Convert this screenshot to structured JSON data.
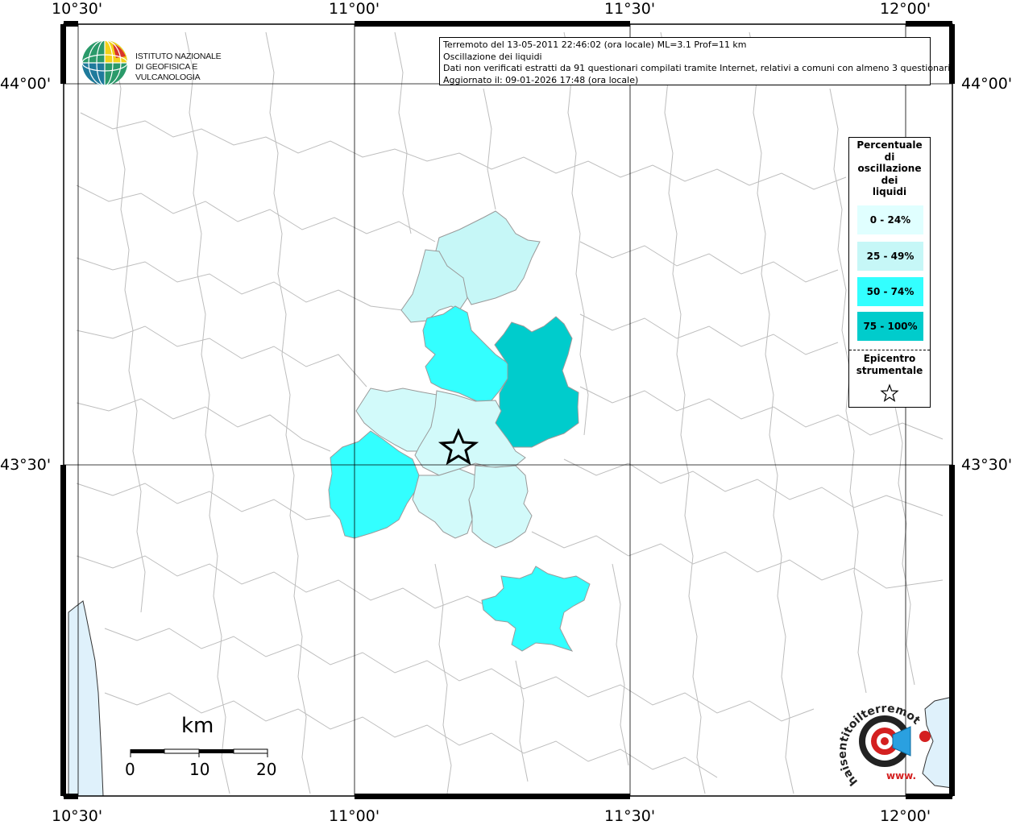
{
  "header": {
    "event_line": "Terremoto del 13-05-2011 22:46:02 (ora locale) ML=3.1 Prof=11 km",
    "parameter_line": "Oscillazione dei liquidi",
    "source_line": "Dati non verificati estratti da 91 questionari compilati tramite Internet, relativi a comuni con almeno 3 questionari.",
    "updated_line": "Aggiornato il: 09-01-2026 17:48 (ora locale)"
  },
  "institute_logo": {
    "line1": "ISTITUTO NAZIONALE",
    "line2": "DI GEOFISICA E VULCANOLOGIA"
  },
  "axes": {
    "top_labels": [
      "10°30'",
      "11°00'",
      "11°30'",
      "12°00'"
    ],
    "bottom_labels": [
      "10°30'",
      "11°00'",
      "11°30'",
      "12°00'"
    ],
    "left_labels": [
      "44°00'",
      "43°30'"
    ],
    "right_labels": [
      "44°00'",
      "43°30'"
    ]
  },
  "legend": {
    "title_lines": [
      "Percentuale",
      "di",
      "oscillazione",
      "dei",
      "liquidi"
    ],
    "classes": [
      {
        "label": "0 - 24%",
        "color": "#e0ffff"
      },
      {
        "label": "25 - 49%",
        "color": "#c6f7f7"
      },
      {
        "label": "50 - 74%",
        "color": "#33ffff"
      },
      {
        "label": "75 - 100%",
        "color": "#00cccc"
      }
    ],
    "epicenter_lines": [
      "Epicentro",
      "strumentale"
    ]
  },
  "scale_bar": {
    "unit": "km",
    "ticks": [
      "0",
      "10",
      "20"
    ]
  },
  "colors": {
    "sea": "#dff1fb",
    "border_lines": "#bbbbbb",
    "grid": "#000000"
  },
  "haisentito_logo": {
    "text": "haisentitoilterremoto.it",
    "alt_text": "www."
  }
}
